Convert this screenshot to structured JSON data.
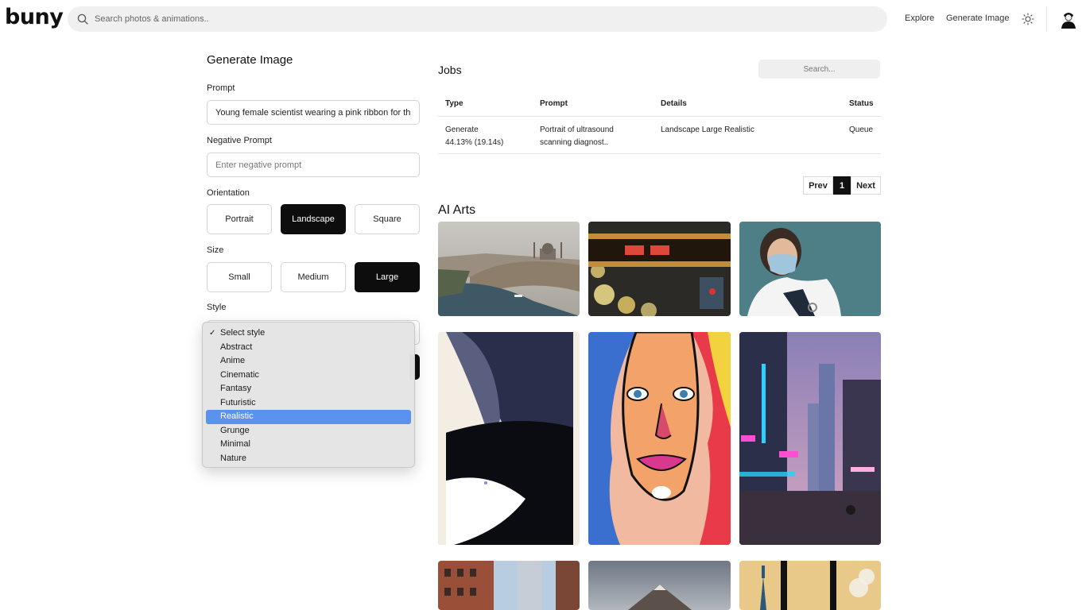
{
  "header": {
    "logo": "buny",
    "search_placeholder": "Search photos & animations..",
    "nav": {
      "explore": "Explore",
      "generate": "Generate Image"
    }
  },
  "form": {
    "title": "Generate Image",
    "prompt_label": "Prompt",
    "prompt_value": "Young female scientist wearing a pink ribbon for th",
    "negative_label": "Negative Prompt",
    "negative_placeholder": "Enter negative prompt",
    "orientation_label": "Orientation",
    "orientation_options": [
      "Portrait",
      "Landscape",
      "Square"
    ],
    "orientation_selected": "Landscape",
    "size_label": "Size",
    "size_options": [
      "Small",
      "Medium",
      "Large"
    ],
    "size_selected": "Large",
    "style_label": "Style",
    "style_options": [
      "Select style",
      "Abstract",
      "Anime",
      "Cinematic",
      "Fantasy",
      "Futuristic",
      "Realistic",
      "Grunge",
      "Minimal",
      "Nature"
    ],
    "style_checked": "Select style",
    "style_highlighted": "Realistic"
  },
  "jobs": {
    "title": "Jobs",
    "search_placeholder": "Search...",
    "columns": [
      "Type",
      "Prompt",
      "Details",
      "Status"
    ],
    "rows": [
      {
        "type": "Generate",
        "progress": "44.13% (19.14s)",
        "prompt_line1": "Portrait of ultrasound",
        "prompt_line2": "scanning diagnost..",
        "details": "Landscape Large Realistic",
        "status": "Queue"
      }
    ],
    "pagination": {
      "prev": "Prev",
      "page": "1",
      "next": "Next"
    }
  },
  "arts": {
    "title": "AI Arts",
    "images": [
      "city-waterfront-mosque",
      "neon-sign-close-up",
      "masked-doctor-stethoscope",
      "planet-space-abstract",
      "pop-art-woman-face",
      "cyberpunk-neon-street",
      "brick-skyscrapers",
      "mountain-peak",
      "chrysler-building-art-deco"
    ]
  }
}
